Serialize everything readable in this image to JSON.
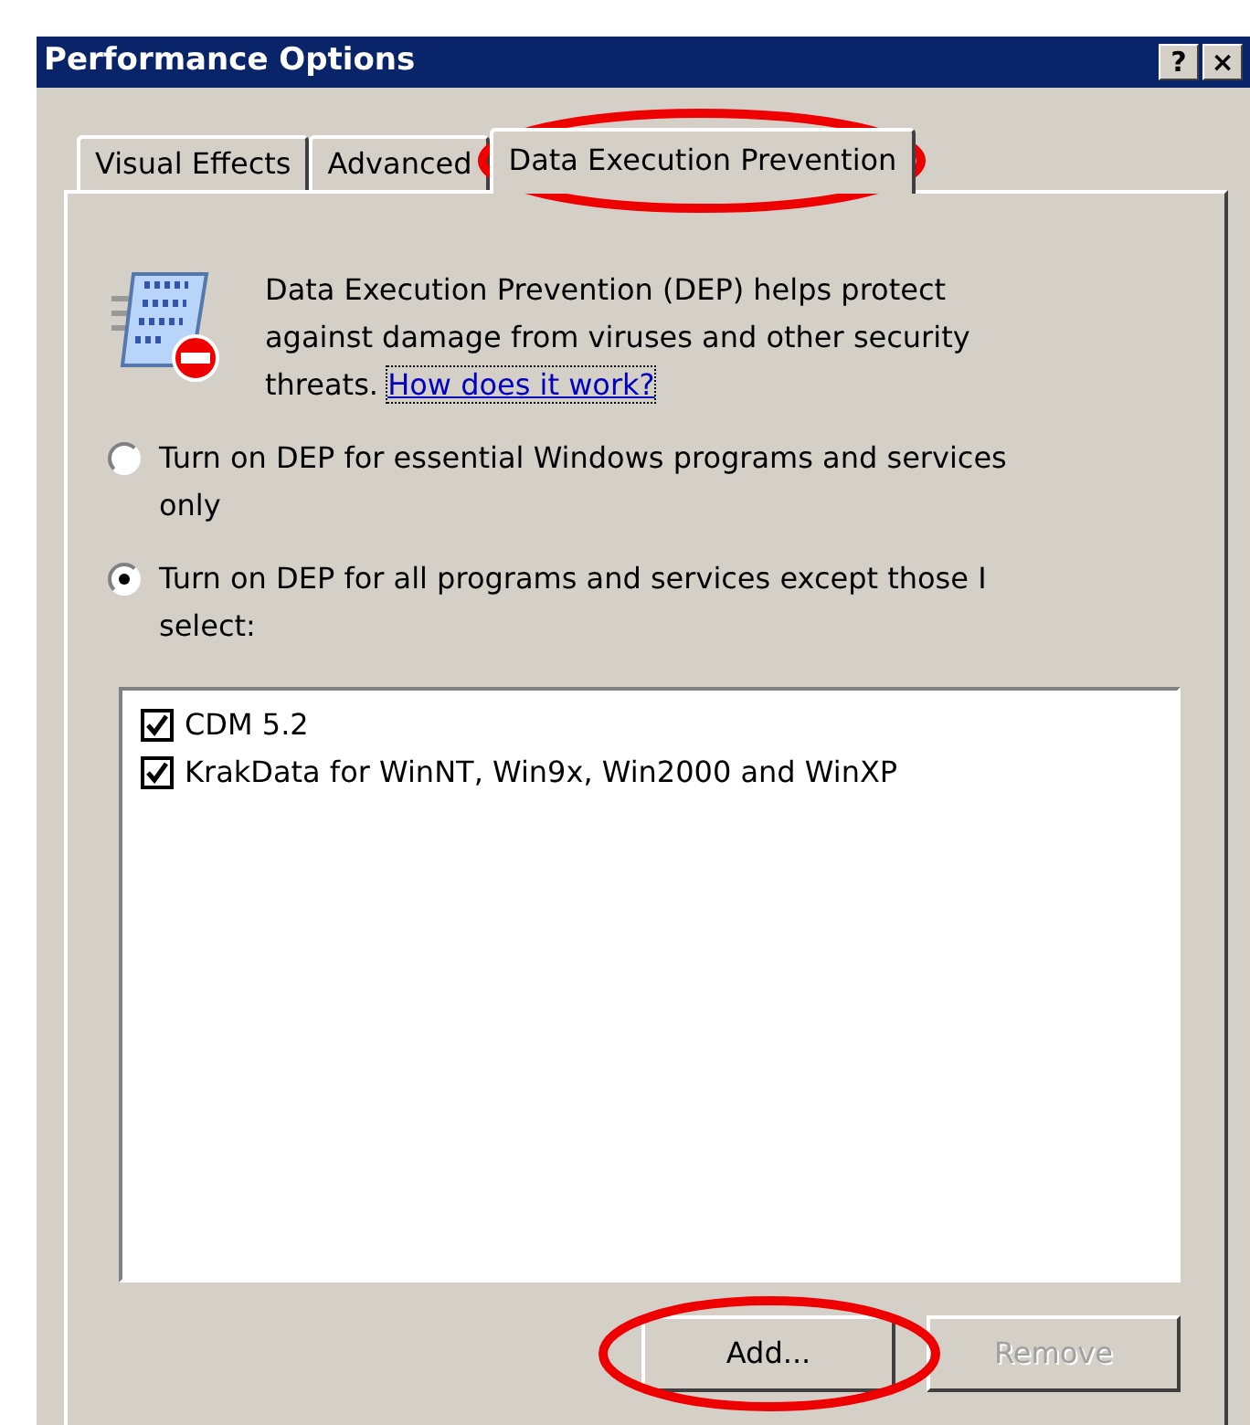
{
  "window": {
    "title": "Performance Options",
    "title_buttons": [
      "?",
      "×"
    ]
  },
  "tabs": [
    {
      "label": "Visual Effects",
      "selected": false,
      "highlighted": false
    },
    {
      "label": "Advanced",
      "selected": false,
      "highlighted": false
    },
    {
      "label": "Data Execution Prevention",
      "selected": true,
      "highlighted": true
    }
  ],
  "description": {
    "text": "Data Execution Prevention (DEP) helps protect against damage from viruses and other security threats.",
    "link": "How does it work?"
  },
  "options": [
    {
      "label": "Turn on DEP for essential Windows programs and services only",
      "selected": false
    },
    {
      "label": "Turn on DEP for all programs and services except those I select:",
      "selected": true
    }
  ],
  "programs": [
    {
      "label": "CDM 5.2",
      "checked": true
    },
    {
      "label": "KrakData for WinNT, Win9x, Win2000 and WinXP",
      "checked": true
    }
  ],
  "buttons": [
    {
      "label": "Add...",
      "disabled": false,
      "highlighted": true
    },
    {
      "label": "Remove",
      "disabled": true,
      "highlighted": false
    }
  ]
}
